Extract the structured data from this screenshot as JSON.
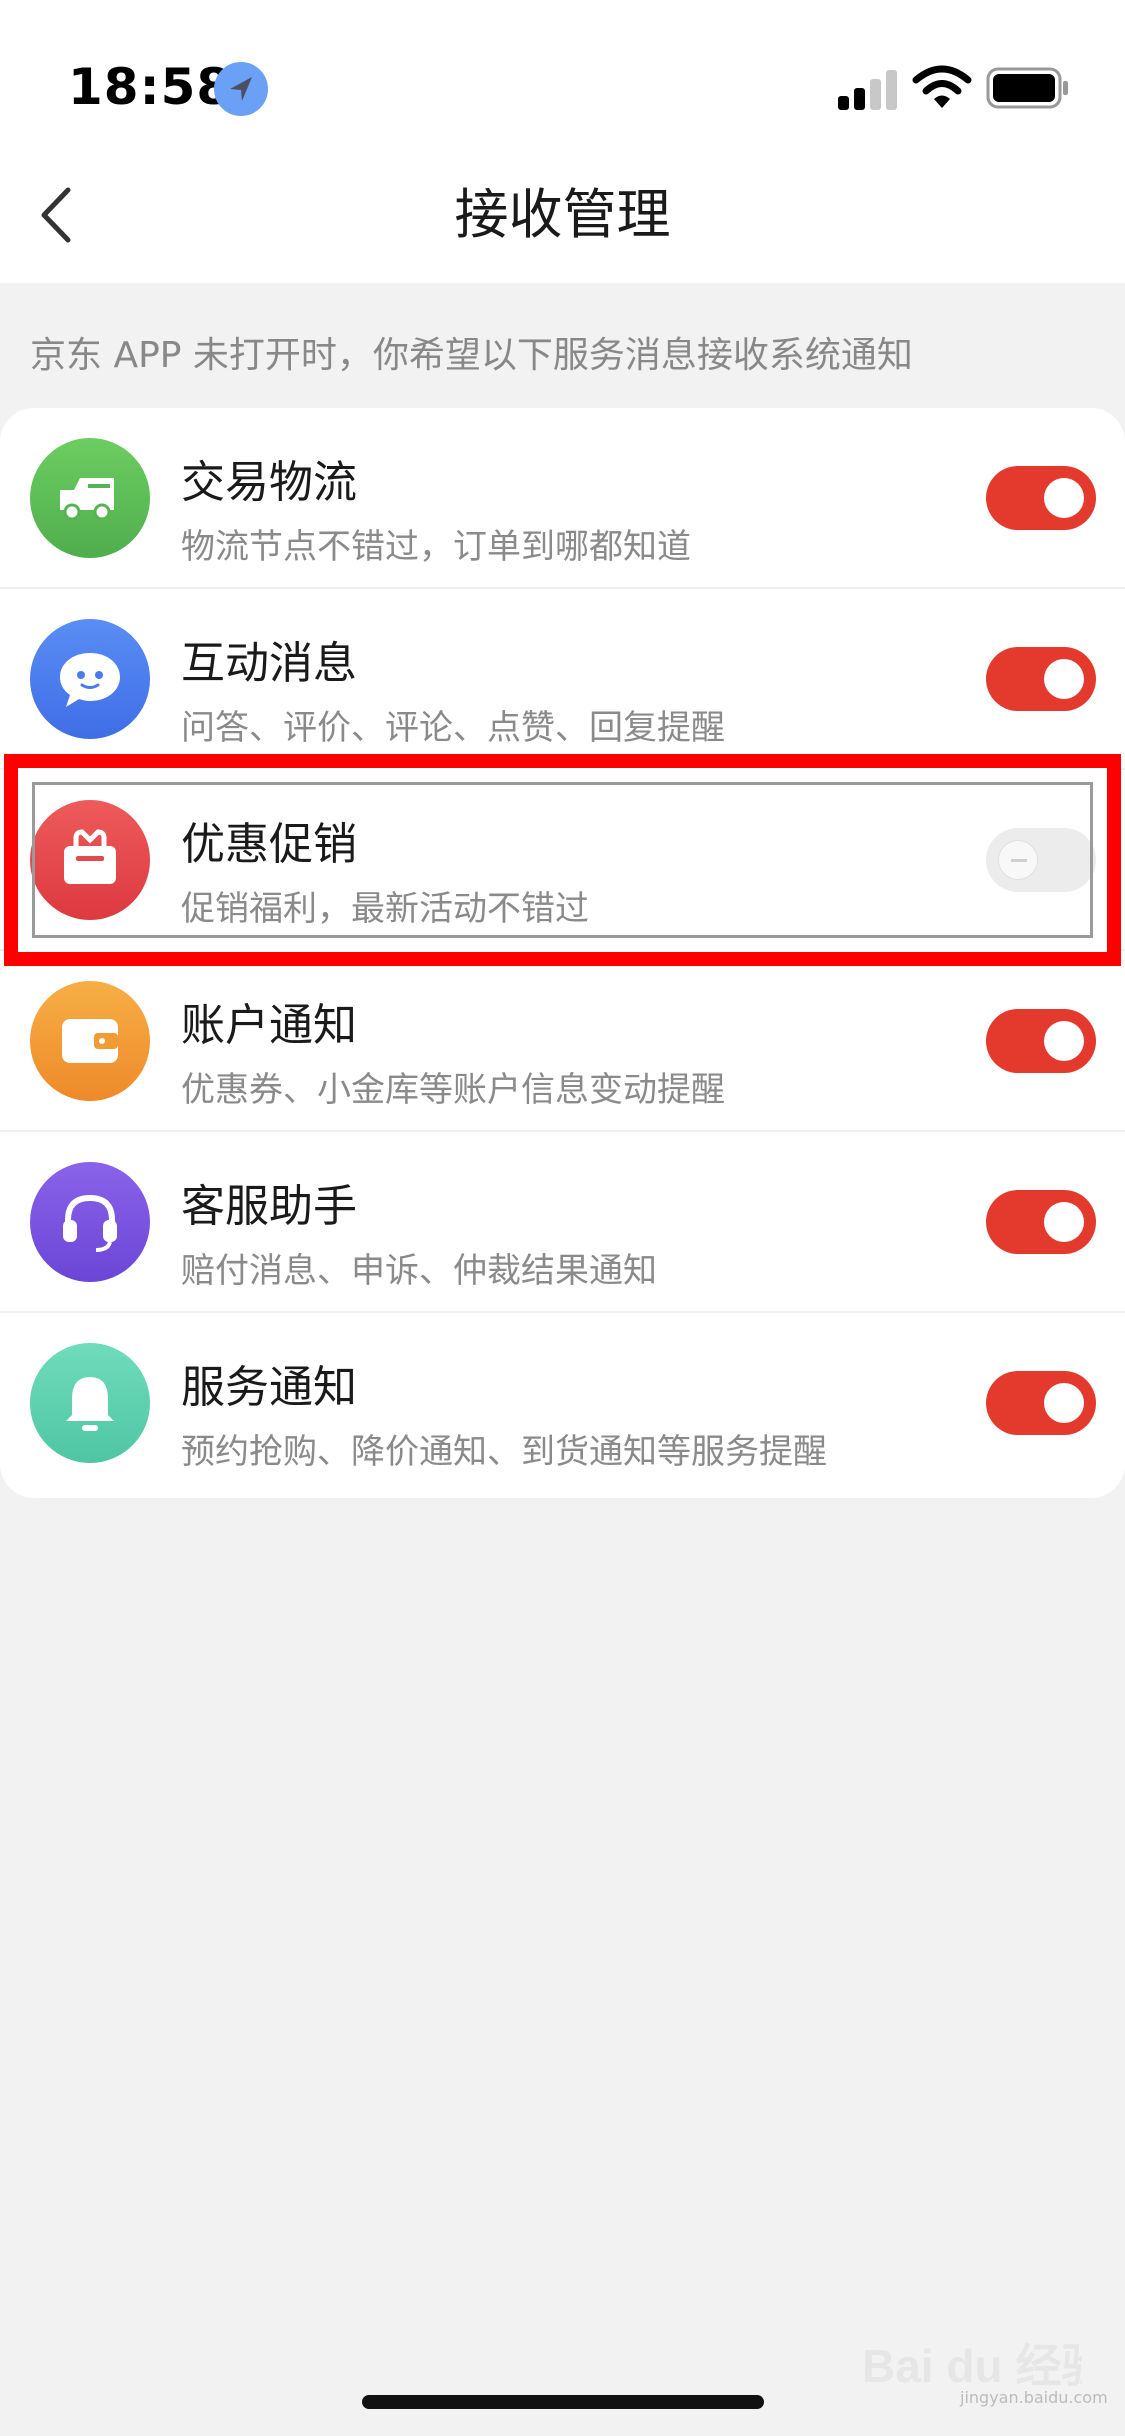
{
  "status_bar": {
    "time": "18:58",
    "location_icon": "location-arrow-icon",
    "signal_icon": "cellular-signal-icon",
    "wifi_icon": "wifi-icon",
    "battery_icon": "battery-icon"
  },
  "nav": {
    "back_icon": "chevron-left-icon",
    "title": "接收管理"
  },
  "hint": "京东 APP 未打开时，你希望以下服务消息接收系统通知",
  "rows": [
    {
      "title": "交易物流",
      "subtitle": "物流节点不错过，订单到哪都知道",
      "icon": "delivery-truck-icon",
      "icon_color": "#5cbf5a",
      "enabled": true
    },
    {
      "title": "互动消息",
      "subtitle": "问答、评价、评论、点赞、回复提醒",
      "icon": "chat-bubble-icon",
      "icon_color": "#4f7ef0",
      "enabled": true
    },
    {
      "title": "优惠促销",
      "subtitle": "促销福利，最新活动不错过",
      "icon": "gift-box-icon",
      "icon_color": "#e54a4c",
      "enabled": false
    },
    {
      "title": "账户通知",
      "subtitle": "优惠券、小金库等账户信息变动提醒",
      "icon": "wallet-icon",
      "icon_color": "#f39a33",
      "enabled": true
    },
    {
      "title": "客服助手",
      "subtitle": "赔付消息、申诉、仲裁结果通知",
      "icon": "headset-icon",
      "icon_color": "#7a55e0",
      "enabled": true
    },
    {
      "title": "服务通知",
      "subtitle": "预约抢购、降价通知、到货通知等服务提醒",
      "icon": "bell-icon",
      "icon_color": "#5fd2b0",
      "enabled": true
    }
  ],
  "colors": {
    "toggle_on": "#e43a2e",
    "highlight": "#ff0000"
  },
  "watermark": {
    "brand": "Bai du 经验",
    "url": "jingyan.baidu.com"
  }
}
